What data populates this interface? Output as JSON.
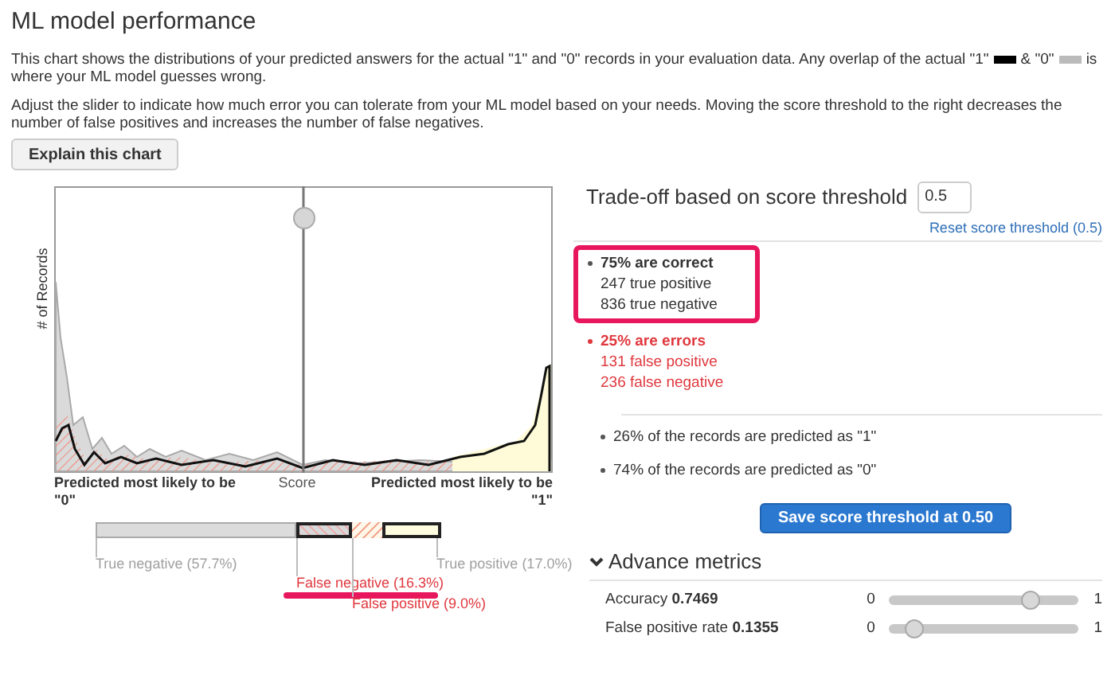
{
  "title": "ML model performance",
  "intro": [
    {
      "kind": "text",
      "text": "This chart shows the distributions of your predicted answers for the actual \"1\" and \"0\" records in your evaluation data. Any overlap of the actual \"1\""
    },
    {
      "kind": "swatch",
      "color": "#000000"
    },
    {
      "kind": "text",
      "text": "& \"0\""
    },
    {
      "kind": "swatch",
      "color": "#bbbbbb"
    },
    {
      "kind": "text",
      "text": "is where your ML model guesses wrong."
    }
  ],
  "instructions": "Adjust the slider to indicate how much error you can tolerate from your ML model based on your needs. Moving the score threshold to the right decreases the number of false positives and increases the number of false negatives.",
  "explain_button": "Explain this chart",
  "chart": {
    "ylabel": "# of Records",
    "left_label": "Predicted most likely to be\n\"0\"",
    "center_label": "Score",
    "right_label": "Predicted most likely to be\n\"1\""
  },
  "breakdown": [
    {
      "kind": "true-negative",
      "label": "True negative (57.7%)"
    },
    {
      "kind": "false-negative",
      "label": "False negative (16.3%)",
      "highlighted": true
    },
    {
      "kind": "false-positive",
      "label": "False positive (9.0%)",
      "highlighted": false
    },
    {
      "kind": "true-positive",
      "label": "True positive (17.0%)"
    }
  ],
  "tradeoff": {
    "title": "Trade-off based on score threshold",
    "value": "0.5",
    "reset_link": "Reset score threshold (0.5)"
  },
  "groups": [
    {
      "kind": "correct",
      "highlighted": true,
      "heading": "75% are correct",
      "lines": [
        "247 true positive",
        "836 true negative"
      ]
    },
    {
      "kind": "error",
      "highlighted": false,
      "heading": "25% are errors",
      "lines": [
        "131 false positive",
        "236 false negative"
      ]
    }
  ],
  "predictions": [
    "26% of the records are predicted as \"1\"",
    "74% of the records are predicted as \"0\""
  ],
  "save_button": "Save score threshold at 0.50",
  "advanced": {
    "title": "Advance metrics",
    "expanded": true,
    "metrics": [
      {
        "label": "Accuracy",
        "value": "0.7469",
        "min": "0",
        "max": "1",
        "level": 0.7469
      },
      {
        "label": "False positive rate",
        "value": "0.1355",
        "min": "0",
        "max": "1",
        "level": 0.1355
      }
    ]
  }
}
